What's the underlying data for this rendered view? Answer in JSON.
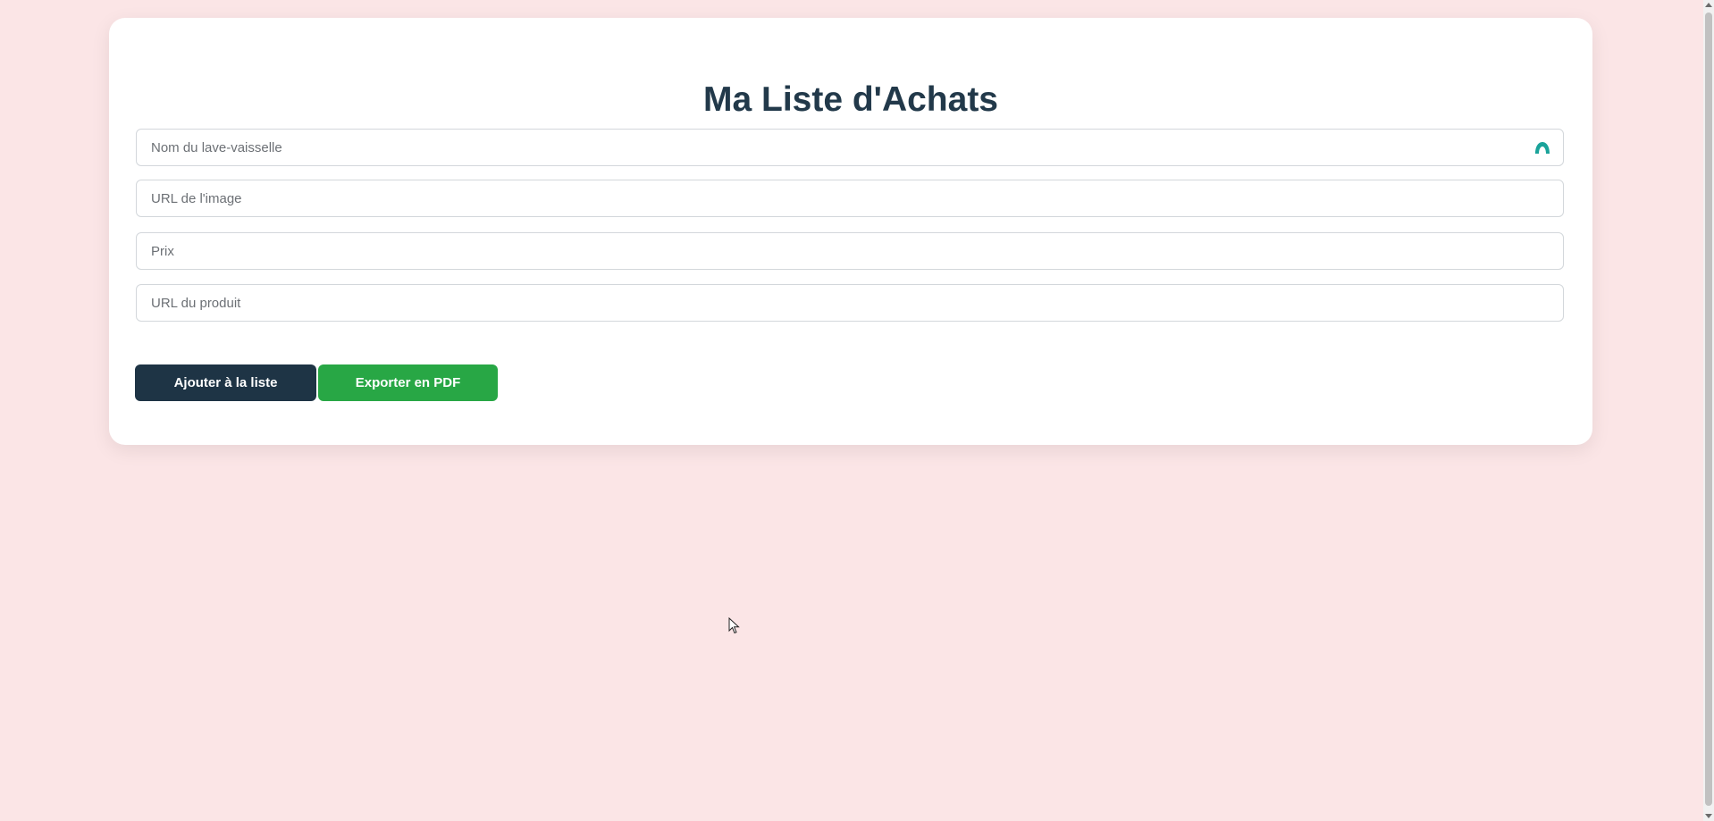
{
  "page": {
    "title": "Ma Liste d'Achats",
    "background_color": "#fbe5e6"
  },
  "form": {
    "name_placeholder": "Nom du lave-vaisselle",
    "image_url_placeholder": "URL de l'image",
    "price_placeholder": "Prix",
    "product_url_placeholder": "URL du produit",
    "name_value": "",
    "image_url_value": "",
    "price_value": "",
    "product_url_value": ""
  },
  "buttons": {
    "add_label": "Ajouter à la liste",
    "export_label": "Exporter en PDF",
    "add_color": "#1e3445",
    "export_color": "#28a745"
  },
  "icons": {
    "field_extension_icon": "autofill-extension-icon",
    "cursor": "mouse-pointer-icon"
  }
}
